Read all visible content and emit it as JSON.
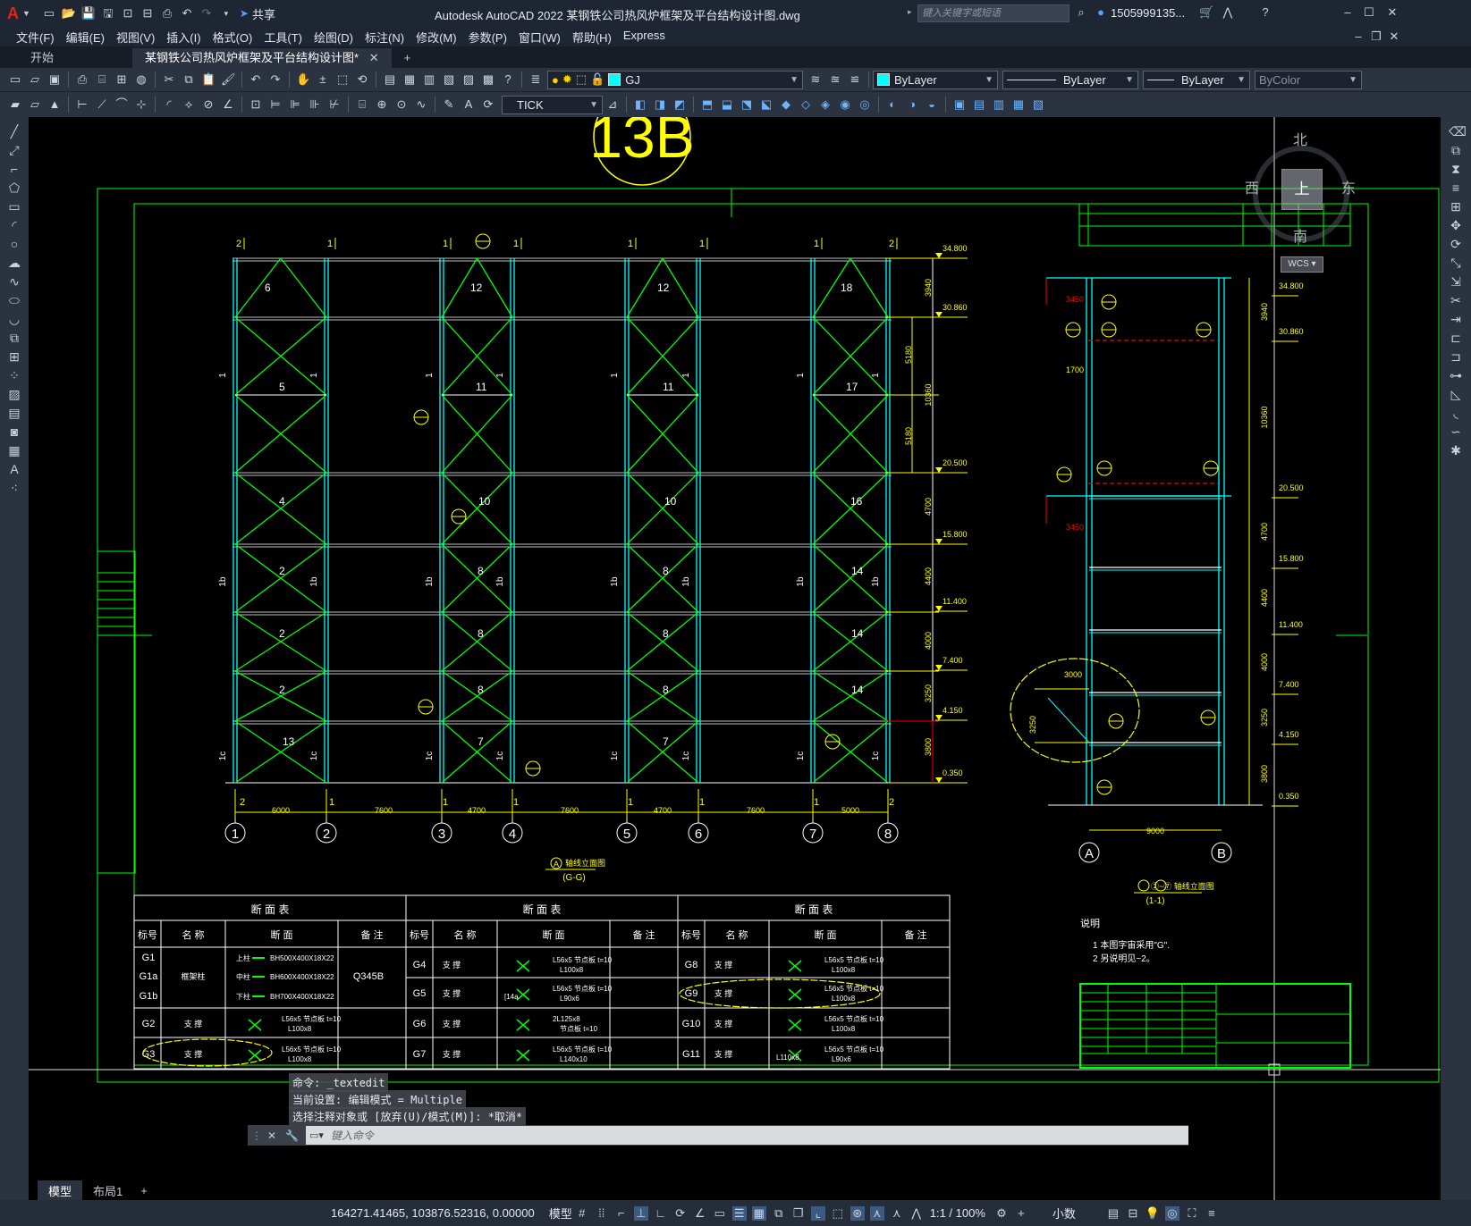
{
  "app": {
    "title": "Autodesk AutoCAD 2022    某钢铁公司热风炉框架及平台结构设计图.dwg",
    "share_label": "共享",
    "search_placeholder": "键入关键字或短语",
    "user": "1505999135...",
    "logo": "A"
  },
  "menu": [
    "文件(F)",
    "编辑(E)",
    "视图(V)",
    "插入(I)",
    "格式(O)",
    "工具(T)",
    "绘图(D)",
    "标注(N)",
    "修改(M)",
    "参数(P)",
    "窗口(W)",
    "帮助(H)",
    "Express"
  ],
  "file_tabs": {
    "start": "开始",
    "active": "某钢铁公司热风炉框架及平台结构设计图*",
    "add": "+"
  },
  "toolbar": {
    "layer_name": "GJ",
    "layer_color": "#00ffff",
    "color_value": "ByLayer",
    "linetype_value": "ByLayer",
    "lineweight_value": "ByLayer",
    "plotstyle_value": "ByColor",
    "dimstyle_value": "TICK"
  },
  "viewcube": {
    "north": "北",
    "south": "南",
    "east": "东",
    "west": "西",
    "top": "上",
    "ucs": "WCS"
  },
  "drawing": {
    "top_callout": "13B",
    "left_elevation": {
      "top_labels": [
        "2",
        "1",
        "1",
        "1",
        "1",
        "1",
        "2"
      ],
      "panel_numbers": [
        "6",
        "5",
        "4",
        "2",
        "2",
        "2",
        "13",
        "12",
        "11",
        "10",
        "8",
        "8",
        "8",
        "7",
        "12",
        "11",
        "10",
        "8",
        "8",
        "8",
        "7",
        "18",
        "17",
        "16",
        "14",
        "14",
        "14"
      ],
      "column_marks": [
        "1",
        "1b",
        "1c"
      ],
      "elevations": [
        "34.800",
        "30.860",
        "20.500",
        "15.800",
        "11.400",
        "7.400",
        "4.150",
        "0.350"
      ],
      "dims_right": [
        "3940",
        "5180",
        "10360",
        "5180",
        "4700",
        "4400",
        "4000",
        "3250",
        "3800"
      ],
      "dims_bottom": [
        "6000",
        "7600",
        "4700",
        "7600",
        "4700",
        "7600",
        "5000"
      ],
      "axes": [
        "1",
        "2",
        "3",
        "4",
        "5",
        "6",
        "7",
        "8"
      ],
      "title_circle": "A",
      "title_text": "轴线立面图",
      "subtitle": "(G-G)"
    },
    "right_section": {
      "elevations": [
        "34.800",
        "30.860",
        "20.500",
        "15.800",
        "11.400",
        "7.400",
        "4.150",
        "0.350"
      ],
      "dims_left": [
        "3450",
        "1700",
        "3450",
        "3000",
        "3250"
      ],
      "dims_right": [
        "3940",
        "10360",
        "4700",
        "4400",
        "4000",
        "3250",
        "3800"
      ],
      "dim_bottom": "9000",
      "axes": [
        "A",
        "B"
      ],
      "title_text": "②~⑦ 轴线立面图",
      "subtitle": "(1-1)"
    },
    "notes": {
      "heading": "说明",
      "lines": [
        "1 本图字宙采用\"G\".",
        "2 另说明见~2。"
      ]
    },
    "section_tables": {
      "title": "断 面 表",
      "headers": [
        "标号",
        "名 称",
        "断 面",
        "备 注"
      ],
      "table1": [
        {
          "mark": "G1",
          "name": "",
          "section": "BH500X400X18X22",
          "tag": "上柱",
          "note": ""
        },
        {
          "mark": "G1a",
          "name": "框架柱",
          "section": "BH600X400X18X22",
          "tag": "中柱",
          "note": "Q345B"
        },
        {
          "mark": "G1b",
          "name": "",
          "section": "BH700X400X18X22",
          "tag": "下柱",
          "note": ""
        },
        {
          "mark": "G2",
          "name": "支 撑",
          "section": "L56x5 节点板 t=10",
          "section2": "L100x8",
          "note": ""
        },
        {
          "mark": "G3",
          "name": "支 撑",
          "section": "L56x5 节点板 t=10",
          "section2": "L100x8",
          "note": ""
        }
      ],
      "table2": [
        {
          "mark": "G4",
          "name": "支 撑",
          "section": "L56x5 节点板 t=10",
          "section2": "L100x8"
        },
        {
          "mark": "G5",
          "name": "支 撑",
          "section": "L56x5 节点板 t=10",
          "section2": "L90x6",
          "extra": "[14a"
        },
        {
          "mark": "G6",
          "name": "支 撑",
          "section": "2L125x8",
          "section2": "节点板 t=10"
        },
        {
          "mark": "G7",
          "name": "支 撑",
          "section": "L56x5 节点板 t=10",
          "section2": "L140x10"
        }
      ],
      "table3": [
        {
          "mark": "G8",
          "name": "支 撑",
          "section": "L56x5 节点板 t=10",
          "section2": "L100x8"
        },
        {
          "mark": "G9",
          "name": "支 撑",
          "section": "L56x5 节点板 t=10",
          "section2": "L100x8"
        },
        {
          "mark": "G10",
          "name": "支 撑",
          "section": "L56x5 节点板 t=10",
          "section2": "L100x8"
        },
        {
          "mark": "G11",
          "name": "支 撑",
          "section": "L56x5 节点板 t=10",
          "section2": "L90x6",
          "extra": "L110x8"
        }
      ]
    }
  },
  "command": {
    "history": [
      "命令: _textedit",
      "当前设置: 编辑模式 = Multiple",
      "选择注释对象或 [放弃(U)/模式(M)]: *取消*"
    ],
    "prompt_placeholder": "键入命令"
  },
  "status": {
    "tabs": [
      "模型",
      "布局1",
      "+"
    ],
    "coords": "164271.41465, 103876.52316, 0.00000",
    "space": "模型",
    "scale": "1:1 / 100%",
    "units": "小数"
  },
  "colors": {
    "green": "#00ff00",
    "cyan": "#00ffff",
    "yellow": "#ffff00",
    "red": "#ff0000",
    "white": "#ffffff"
  }
}
